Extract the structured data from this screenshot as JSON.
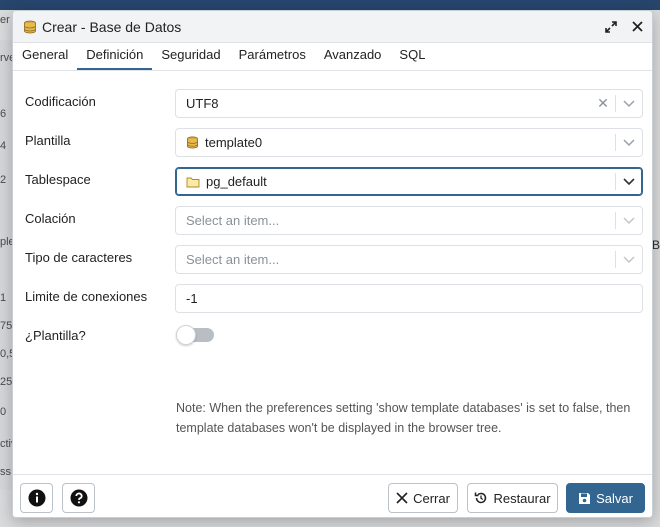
{
  "dialog": {
    "title": "Crear - Base de Datos",
    "title_icon": "database-icon"
  },
  "tabs": [
    {
      "label": "General"
    },
    {
      "label": "Definición"
    },
    {
      "label": "Seguridad"
    },
    {
      "label": "Parámetros"
    },
    {
      "label": "Avanzado"
    },
    {
      "label": "SQL"
    }
  ],
  "active_tab": "Definición",
  "form": {
    "encoding": {
      "label": "Codificación",
      "value": "UTF8"
    },
    "template": {
      "label": "Plantilla",
      "value": "template0",
      "icon": "database-icon"
    },
    "tablespace": {
      "label": "Tablespace",
      "value": "pg_default",
      "icon": "folder-icon"
    },
    "collation": {
      "label": "Colación",
      "placeholder": "Select an item..."
    },
    "ctype": {
      "label": "Tipo de caracteres",
      "placeholder": "Select an item..."
    },
    "connlimit": {
      "label": "Limite de conexiones",
      "value": "-1"
    },
    "is_template": {
      "label": "¿Plantilla?",
      "enabled": false
    },
    "note": "Note: When the preferences setting 'show template databases' is set to false, then template databases won't be displayed in the browser tree."
  },
  "footer": {
    "info_icon": "info-icon",
    "help_icon": "help-icon",
    "close_label": "Cerrar",
    "reset_label": "Restaurar",
    "save_label": "Salvar"
  },
  "colors": {
    "accent": "#326690",
    "tab_underline": "#326690"
  },
  "background": {
    "left_fragments": [
      "er",
      "rve",
      "6",
      "4",
      "2",
      "ple",
      "1",
      "75",
      "0,5",
      "25",
      "0",
      "ctiv",
      "ss"
    ],
    "right_fragment": "B"
  }
}
